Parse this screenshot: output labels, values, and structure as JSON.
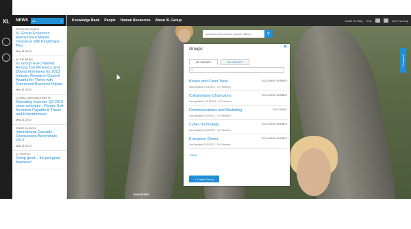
{
  "topnav": {
    "links": [
      "Knowledge Bank",
      "People",
      "Human Resources",
      "About XL Group"
    ],
    "right": [
      "Inside XL Blog",
      "Help",
      "John Fanning"
    ]
  },
  "news": {
    "title": "NEWS",
    "filter": "All",
    "items": [
      {
        "category": "Press Releases",
        "headline": "XL Group Enhances Reinsurance Marine Insurance with KingSnape Plus",
        "date": "May 11 2013"
      },
      {
        "category": "In The News",
        "headline": "XL Group Exec Named Among Top PR Execs and Others Nominees for 2013 Industry Research Council Awards for Thrive with Connected Business Impact",
        "date": "May 11 2013"
      },
      {
        "category": "Global Announcements",
        "headline": "Operating expense Q2 2013 close schedule - People Soft Accounts Payable & Travel and Entertainment",
        "date": "May 11 2013"
      },
      {
        "category": "Inside XL Blog",
        "headline": "International Casualty - Reinsurance Benchmark 2013",
        "date": "May 11 2013"
      },
      {
        "category": "XL People",
        "headline": "Going good... it's just good business!",
        "date": ""
      }
    ]
  },
  "search": {
    "placeholder": "search for documents, people, offices"
  },
  "modal": {
    "title": "Groups",
    "tabs": [
      "MY GROUPS",
      "ALL GROUPS"
    ],
    "groups": [
      {
        "name": "Broker and Client Tools",
        "meta": "Last updated: 5/13/2013 · 13 Followers",
        "status": "FOLLOWING MEMBER"
      },
      {
        "name": "Collaboration Champions",
        "meta": "Last updated: 11/15/2013 · 10 Followers",
        "status": "FOLLOWING MEMBER"
      },
      {
        "name": "Communications and Marketing",
        "meta": "Last updated: 5/13/2013 · 13 Followers",
        "status": "FOLLOWING"
      },
      {
        "name": "Cyber Technology",
        "meta": "Last updated: 5/13/2013 · 18 Followers",
        "status": "FOLLOWING MEMBER"
      },
      {
        "name": "Enterprise Owner",
        "meta": "Last updated: 5/20/2013 · 18 Followers",
        "status": "FOLLOWING MEMBER"
      }
    ],
    "next": "Next",
    "create_label": "+ Create Group"
  },
  "feedback": "Feedback",
  "favorites": "FAVORITES",
  "colors": {
    "accent": "#1f8fd6",
    "dark": "#1e1e1e"
  }
}
